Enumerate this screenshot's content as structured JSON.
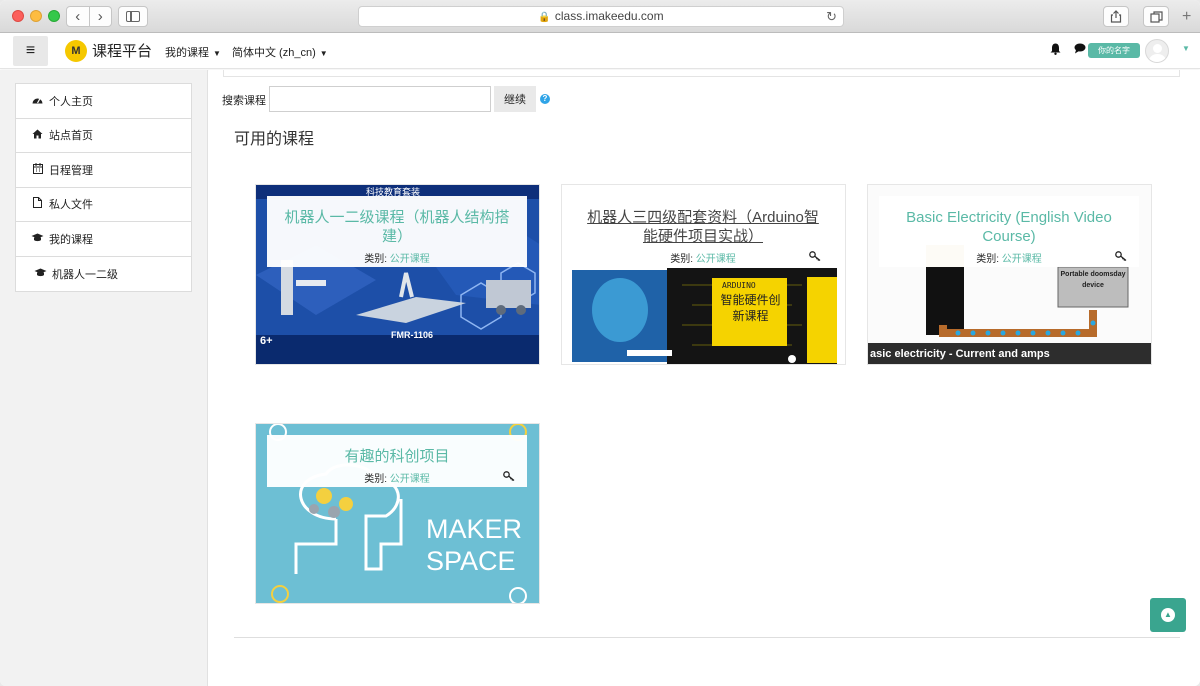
{
  "browser": {
    "url": "class.imakeedu.com",
    "back_icon": "chevron-left-icon",
    "forward_icon": "chevron-right-icon"
  },
  "navbar": {
    "site_name": "课程平台",
    "logo_text": "M",
    "my_courses": "我的课程",
    "language": "简体中文 (zh_cn)",
    "user_name": "你的名字",
    "accent": "#5ab9a6"
  },
  "drawer": {
    "items": [
      {
        "label": "个人主页",
        "icon": "dashboard-icon"
      },
      {
        "label": "站点首页",
        "icon": "home-icon"
      },
      {
        "label": "日程管理",
        "icon": "calendar-icon"
      },
      {
        "label": "私人文件",
        "icon": "file-icon"
      },
      {
        "label": "我的课程",
        "icon": "graduation-cap-icon"
      },
      {
        "label": "机器人一二级",
        "icon": "graduation-cap-icon"
      }
    ]
  },
  "search": {
    "label": "搜索课程",
    "value": "",
    "button": "继续",
    "help": "?"
  },
  "main": {
    "heading": "可用的课程",
    "category_label": "类别:",
    "category_value": "公开课程",
    "courses": [
      {
        "name": "机器人一二级课程（机器人结构搭建）",
        "box_title": "科技教育套装",
        "model_text": "FMR-1106",
        "age_text": "6+"
      },
      {
        "name": "机器人三四级配套资料（Arduino智能硬件项目实战）",
        "box_brand": "ARDUINO",
        "box_text": "智能硬件创新课程"
      },
      {
        "name": "Basic Electricity (English Video Course)",
        "device_label": "Portable doomsday device",
        "caption": "asic electricity - Current and amps"
      },
      {
        "name": "有趣的科创项目",
        "line1": "MAKER",
        "line2": "SPACE"
      }
    ]
  }
}
